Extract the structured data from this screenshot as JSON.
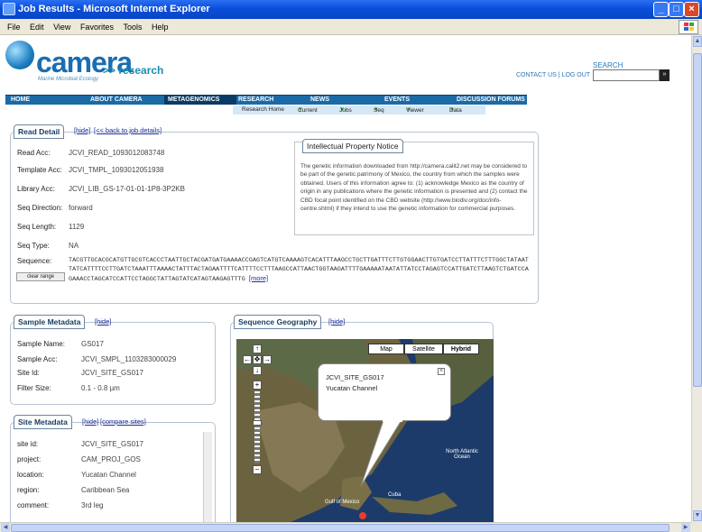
{
  "window": {
    "title": "Job Results - Microsoft Internet Explorer",
    "menu": [
      "File",
      "Edit",
      "View",
      "Favorites",
      "Tools",
      "Help"
    ]
  },
  "header": {
    "logo_word": "camera",
    "logo_tagline": "Marine Microbial Ecology",
    "research_label": ">> research",
    "search_label": "SEARCH",
    "contact_label": "CONTACT US",
    "logout_label": "LOG OUT",
    "search_value": "",
    "search_go": "»"
  },
  "nav": {
    "items": [
      "HOME",
      "ABOUT CAMERA",
      "METAGENOMICS",
      "RESEARCH",
      "NEWS",
      "EVENTS",
      "DISCUSSION FORUMS"
    ],
    "sub": [
      "Research Home",
      "Current",
      "Jobs",
      "Seq",
      "Viewer",
      "Data"
    ]
  },
  "read_detail": {
    "title": "Read Detail",
    "hide": "[hide]",
    "back": "[<< back to job details]",
    "fields": [
      {
        "label": "Read Acc:",
        "value": "JCVI_READ_1093012083748"
      },
      {
        "label": "Template Acc:",
        "value": "JCVI_TMPL_1093012051938"
      },
      {
        "label": "Library Acc:",
        "value": "JCVI_LIB_GS-17-01-01-1P8-3P2KB"
      },
      {
        "label": "Seq Direction:",
        "value": "forward"
      },
      {
        "label": "Seq Length:",
        "value": "1129"
      },
      {
        "label": "Seq Type:",
        "value": "NA"
      },
      {
        "label": "Sequence:",
        "value": ""
      }
    ],
    "sequence": "TACGTTGCACGCATGTTGCGTCACCCTAATTGCTACGATGATGAAAACCGAGTCATGTCAAAAGTCACATTTAAGCCTGCTTGATTTCTTGTGGAACTTGTGATCCTTATTTCTTTGGCTATAATTATCATTTTCCTTGATCTAAATTTAAAACTATTTACTAGAATTTTCATTTTCCTTTAAGCCATTAACTGGTAAGATTTTGAAAAATAATATTATCCTAGAGTCCATTGATCTTAAGTCTGATCCAGAAACCTAGCATCCATTCCTAGGCTATTAGTATCATAGTAAGAGTTTG",
    "more": "[more]",
    "clear_label": "clear range"
  },
  "ip_notice": {
    "title": "Intellectual Property Notice",
    "body": "The genetic information downloaded from http://camera.calit2.net may be considered to be part of the genetic patrimony of Mexico, the country from which the samples were obtained. Users of this information agree to: (1) acknowledge Mexico as the country of origin in any publications where the genetic information is presented and (2) contact the CBD focal point identified on the CBD website (http://www.biodiv.org/doc/info-centre.shtml) if they intend to use the genetic information for commercial purposes."
  },
  "sample_metadata": {
    "title": "Sample Metadata",
    "hide": "[hide]",
    "fields": [
      {
        "label": "Sample Name:",
        "value": "GS017"
      },
      {
        "label": "Sample Acc:",
        "value": "JCVI_SMPL_1103283000029"
      },
      {
        "label": "Site Id:",
        "value": "JCVI_SITE_GS017"
      },
      {
        "label": "Filter Size:",
        "value": "0.1 - 0.8 µm"
      }
    ]
  },
  "site_metadata": {
    "title": "Site Metadata",
    "hide": "[hide]",
    "compare": "[compare sites]",
    "fields": [
      {
        "label": "site id:",
        "value": "JCVI_SITE_GS017"
      },
      {
        "label": "project:",
        "value": "CAM_PROJ_GOS"
      },
      {
        "label": "location:",
        "value": "Yucatan Channel"
      },
      {
        "label": "region:",
        "value": "Caribbean Sea"
      },
      {
        "label": "comment:",
        "value": "3rd leg"
      }
    ]
  },
  "geography": {
    "title": "Sequence Geography",
    "hide": "[hide]",
    "map_buttons": [
      "Map",
      "Satellite",
      "Hybrid"
    ],
    "bubble_site": "JCVI_SITE_GS017",
    "bubble_location": "Yucatan Channel",
    "labels": [
      "Gulf of Mexico",
      "Cuba",
      "North Atlantic Ocean"
    ]
  },
  "colors": {
    "titlebar": "#0a4fd8",
    "nav": "#1b6aa8",
    "nav_active": "#0c3a66",
    "accent": "#f09a1e"
  }
}
